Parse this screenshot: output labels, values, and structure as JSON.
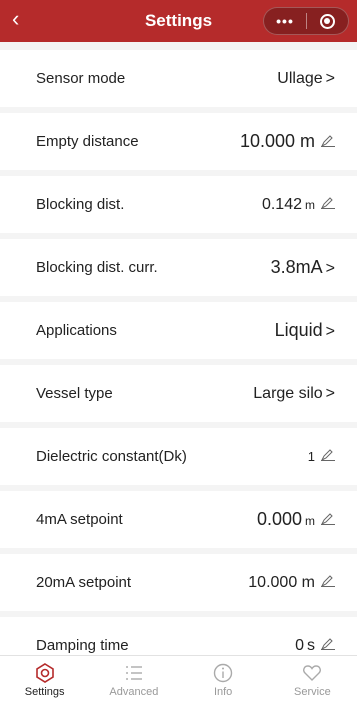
{
  "header": {
    "back_icon": "chevron-left-icon",
    "title": "Settings",
    "more_label": "•••",
    "record_icon": "record-icon",
    "color": "#b52b2b"
  },
  "settings": [
    {
      "label": "Sensor mode",
      "value": "Ullage",
      "unit": "",
      "action": "chevron"
    },
    {
      "label": "Empty distance",
      "value": "10.000 m",
      "unit": "",
      "action": "edit"
    },
    {
      "label": "Blocking dist.",
      "value": "0.142",
      "unit": "m",
      "action": "edit"
    },
    {
      "label": "Blocking dist. curr.",
      "value": "3.8mA",
      "unit": "",
      "action": "chevron"
    },
    {
      "label": "Applications",
      "value": "Liquid",
      "unit": "",
      "action": "chevron"
    },
    {
      "label": "Vessel type",
      "value": "Large silo",
      "unit": "",
      "action": "chevron"
    },
    {
      "label": "Dielectric constant(Dk)",
      "value": "1",
      "unit": "",
      "action": "edit"
    },
    {
      "label": "4mA setpoint",
      "value": "0.000",
      "unit": "m",
      "action": "edit"
    },
    {
      "label": "20mA setpoint",
      "value": "10.000 m",
      "unit": "",
      "action": "edit"
    },
    {
      "label": "Damping time",
      "value": "0",
      "unit": "s",
      "action": "edit"
    }
  ],
  "tabs": [
    {
      "label": "Settings",
      "icon": "settings-icon",
      "active": true
    },
    {
      "label": "Advanced",
      "icon": "list-icon",
      "active": false
    },
    {
      "label": "Info",
      "icon": "info-icon",
      "active": false
    },
    {
      "label": "Service",
      "icon": "heart-icon",
      "active": false
    }
  ],
  "chevron_glyph": ">"
}
